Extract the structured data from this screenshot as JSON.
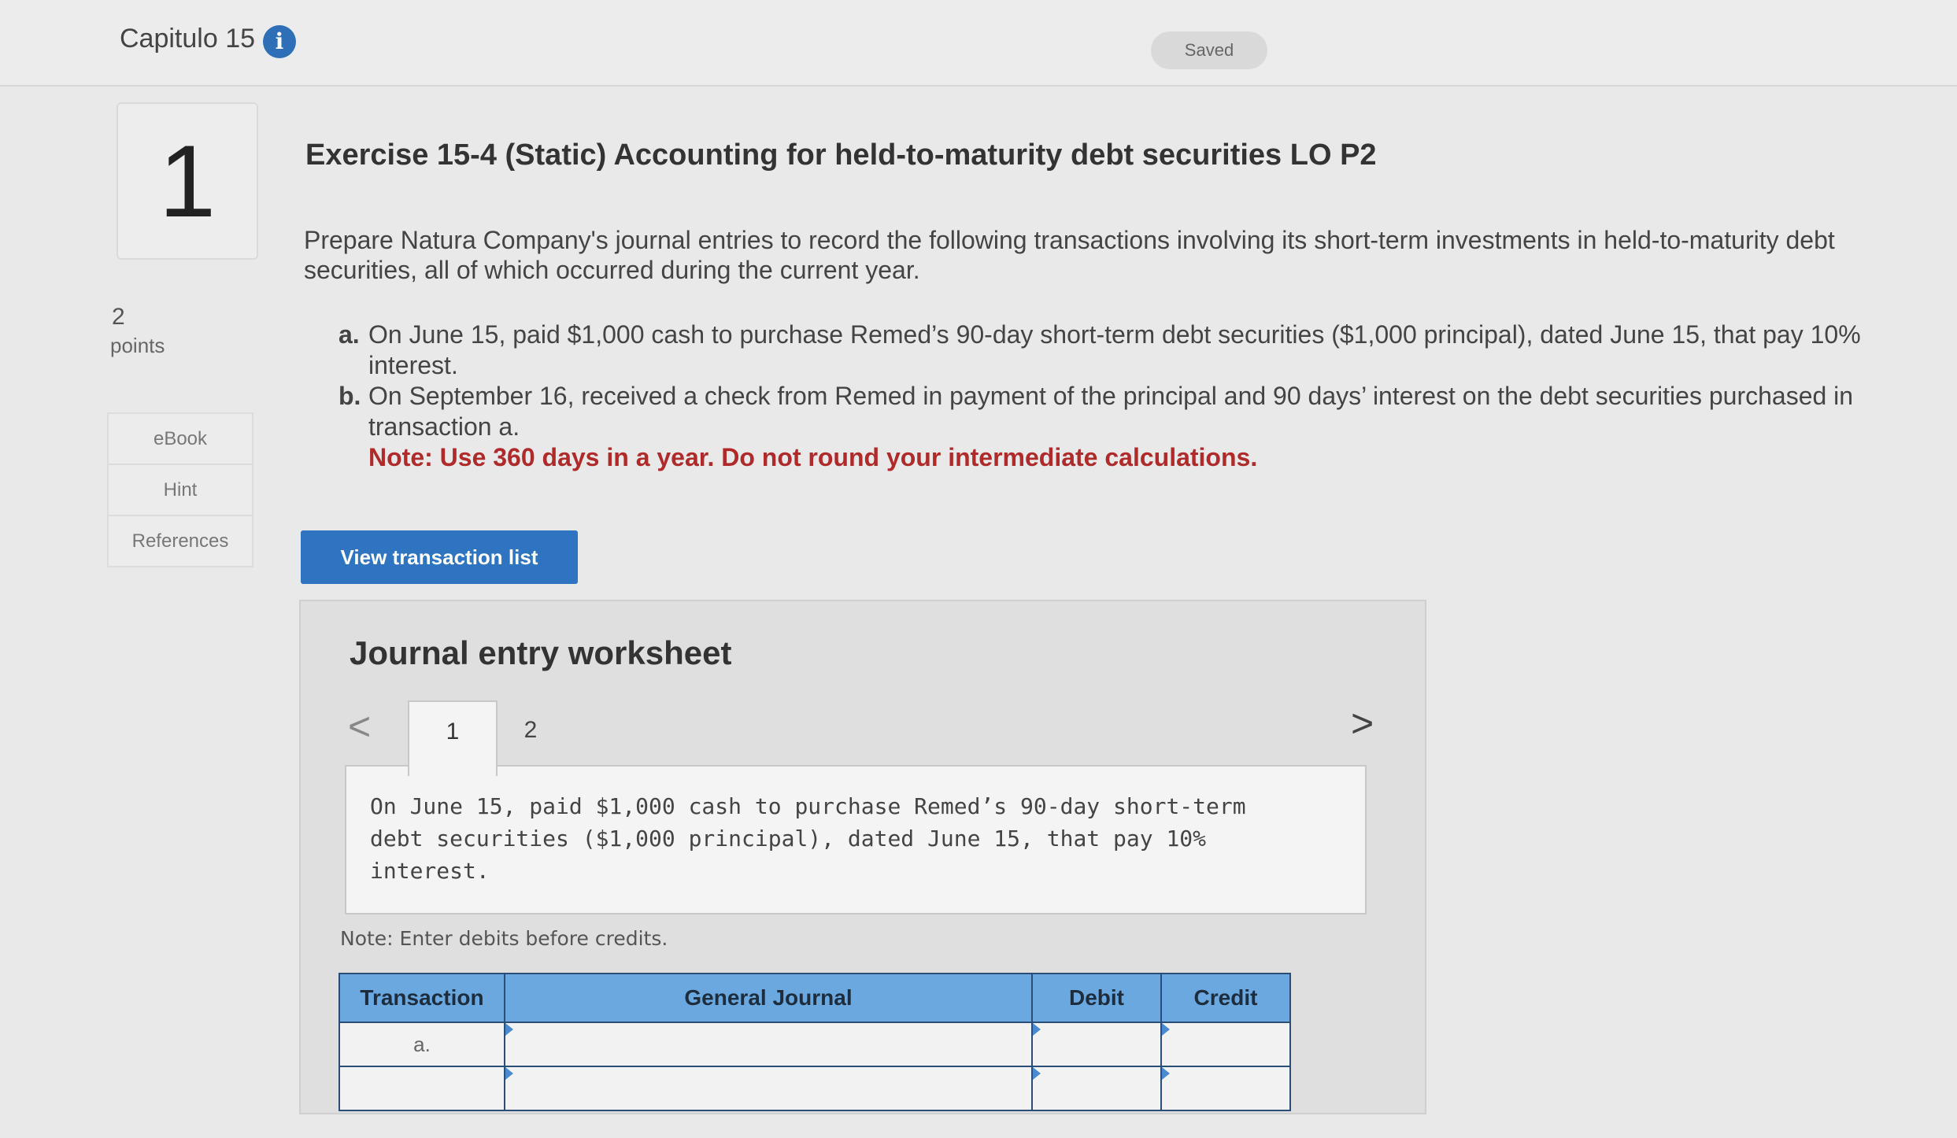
{
  "header": {
    "chapter_title": "Capitulo 15",
    "info_icon": "i",
    "saved_label": "Saved"
  },
  "question": {
    "number": "1",
    "points_value": "2",
    "points_label": "points"
  },
  "sidebar": {
    "tabs": [
      "eBook",
      "Hint",
      "References"
    ]
  },
  "exercise": {
    "title": "Exercise 15-4 (Static) Accounting for held-to-maturity debt securities LO P2",
    "prompt": "Prepare Natura Company's journal entries to record the following transactions involving its short-term investments in held-to-maturity debt securities, all of which occurred during the current year.",
    "items": [
      {
        "letter": "a.",
        "text": "On June 15, paid $1,000 cash to purchase Remed’s 90-day short-term debt securities ($1,000 principal), dated June 15, that pay 10% interest."
      },
      {
        "letter": "b.",
        "text": "On September 16, received a check from Remed in payment of the principal and 90 days’ interest on the debt securities purchased in transaction a."
      }
    ],
    "note": "Note: Use 360 days in a year. Do not round your intermediate calculations."
  },
  "view_button_label": "View transaction list",
  "worksheet": {
    "title": "Journal entry worksheet",
    "prev_icon": "<",
    "next_icon": ">",
    "tabs": [
      "1",
      "2"
    ],
    "active_tab": "1",
    "description": "On June 15, paid $1,000 cash to purchase Remed’s 90-day short-term debt securities ($1,000 principal), dated June 15, that pay 10% interest.",
    "enter_note": "Note: Enter debits before credits.",
    "table": {
      "headers": [
        "Transaction",
        "General Journal",
        "Debit",
        "Credit"
      ],
      "rows": [
        {
          "transaction": "a.",
          "general_journal": "",
          "debit": "",
          "credit": ""
        },
        {
          "transaction": "",
          "general_journal": "",
          "debit": "",
          "credit": ""
        }
      ]
    }
  },
  "colors": {
    "accent": "#2f74c0",
    "table_header": "#6aa8df",
    "note_red": "#b02a2a"
  }
}
